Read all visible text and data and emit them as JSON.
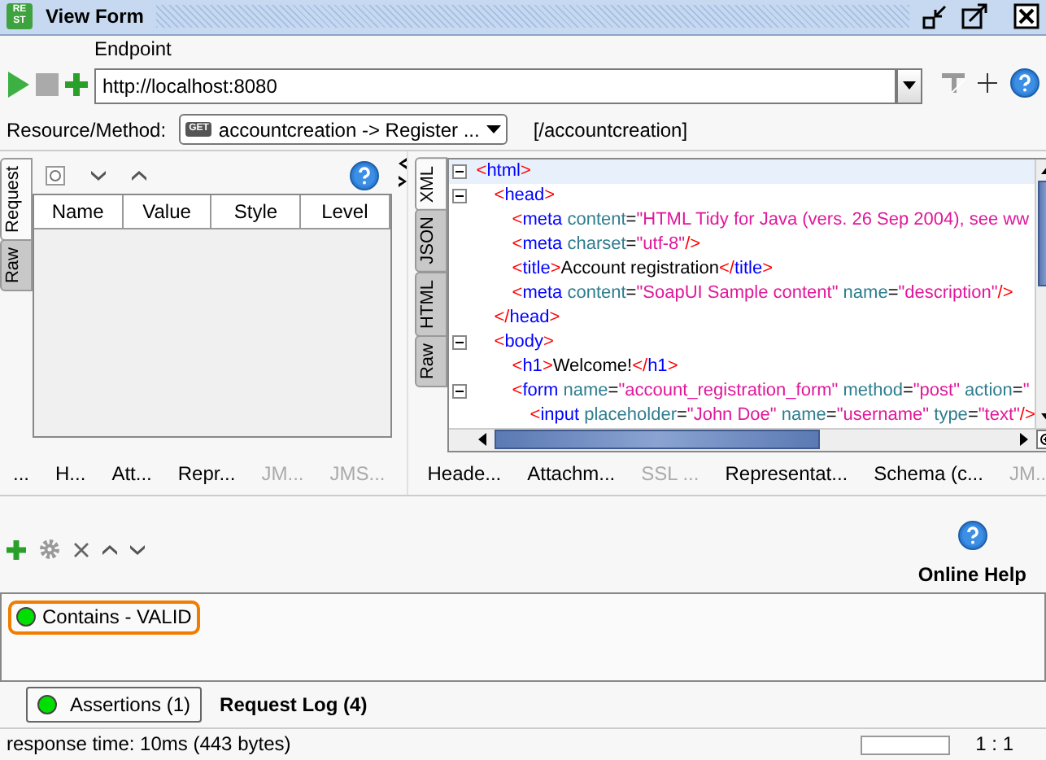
{
  "window": {
    "title": "View Form",
    "icon_text": [
      "RE",
      "ST"
    ]
  },
  "toolbar": {
    "endpoint_label": "Endpoint",
    "endpoint_value": "http://localhost:8080"
  },
  "resource": {
    "label": "Resource/Method:",
    "method": "GET",
    "value": "accountcreation -> Register ...",
    "path": "[/accountcreation]"
  },
  "request_panel": {
    "side_tabs": [
      {
        "label": "Request",
        "selected": true
      },
      {
        "label": "Raw",
        "selected": false
      }
    ],
    "columns": [
      "Name",
      "Value",
      "Style",
      "Level"
    ],
    "bottom_tabs": [
      {
        "label": "...",
        "disabled": false
      },
      {
        "label": "H...",
        "disabled": false
      },
      {
        "label": "Att...",
        "disabled": false
      },
      {
        "label": "Repr...",
        "disabled": false
      },
      {
        "label": "JM...",
        "disabled": true
      },
      {
        "label": "JMS...",
        "disabled": true
      }
    ]
  },
  "response_panel": {
    "side_tabs": [
      {
        "label": "XML",
        "selected": true
      },
      {
        "label": "JSON",
        "selected": false
      },
      {
        "label": "HTML",
        "selected": false
      },
      {
        "label": "Raw",
        "selected": false
      }
    ],
    "code": [
      {
        "selected": true,
        "expanded": true,
        "tokens": [
          {
            "kind": "bracket",
            "text": "<"
          },
          {
            "kind": "name",
            "text": "html"
          },
          {
            "kind": "bracket",
            "text": ">"
          }
        ],
        "children": [
          {
            "selected": false,
            "expanded": true,
            "tokens": [
              {
                "kind": "bracket",
                "text": "<"
              },
              {
                "kind": "name",
                "text": "head"
              },
              {
                "kind": "bracket",
                "text": ">"
              }
            ],
            "children": [
              {
                "selected": false,
                "tokens": [
                  {
                    "kind": "bracket",
                    "text": "<"
                  },
                  {
                    "kind": "name",
                    "text": "meta"
                  },
                  {
                    "kind": "attr",
                    "text": " content"
                  },
                  {
                    "kind": "eq",
                    "text": "="
                  },
                  {
                    "kind": "value",
                    "text": "\"HTML Tidy for Java (vers. 26 Sep 2004), see ww"
                  }
                ]
              },
              {
                "selected": false,
                "tokens": [
                  {
                    "kind": "bracket",
                    "text": "<"
                  },
                  {
                    "kind": "name",
                    "text": "meta"
                  },
                  {
                    "kind": "attr",
                    "text": " charset"
                  },
                  {
                    "kind": "eq",
                    "text": "="
                  },
                  {
                    "kind": "value",
                    "text": "\"utf-8\""
                  },
                  {
                    "kind": "bracket",
                    "text": "/>"
                  }
                ]
              },
              {
                "selected": false,
                "tokens": [
                  {
                    "kind": "bracket",
                    "text": "<"
                  },
                  {
                    "kind": "name",
                    "text": "title"
                  },
                  {
                    "kind": "bracket",
                    "text": ">"
                  },
                  {
                    "kind": "text",
                    "text": "Account registration"
                  },
                  {
                    "kind": "bracket",
                    "text": "</"
                  },
                  {
                    "kind": "name",
                    "text": "title"
                  },
                  {
                    "kind": "bracket",
                    "text": ">"
                  }
                ]
              },
              {
                "selected": false,
                "tokens": [
                  {
                    "kind": "bracket",
                    "text": "<"
                  },
                  {
                    "kind": "name",
                    "text": "meta"
                  },
                  {
                    "kind": "attr",
                    "text": " content"
                  },
                  {
                    "kind": "eq",
                    "text": "="
                  },
                  {
                    "kind": "value",
                    "text": "\"SoapUI Sample content\""
                  },
                  {
                    "kind": "attr",
                    "text": " name"
                  },
                  {
                    "kind": "eq",
                    "text": "="
                  },
                  {
                    "kind": "value",
                    "text": "\"description\""
                  },
                  {
                    "kind": "bracket",
                    "text": "/>"
                  }
                ]
              }
            ]
          },
          {
            "selected": false,
            "tokens": [
              {
                "kind": "bracket",
                "text": "</"
              },
              {
                "kind": "name",
                "text": "head"
              },
              {
                "kind": "bracket",
                "text": ">"
              }
            ]
          },
          {
            "selected": false,
            "expanded": true,
            "tokens": [
              {
                "kind": "bracket",
                "text": "<"
              },
              {
                "kind": "name",
                "text": "body"
              },
              {
                "kind": "bracket",
                "text": ">"
              }
            ],
            "children": [
              {
                "selected": false,
                "tokens": [
                  {
                    "kind": "bracket",
                    "text": "<"
                  },
                  {
                    "kind": "name",
                    "text": "h1"
                  },
                  {
                    "kind": "bracket",
                    "text": ">"
                  },
                  {
                    "kind": "text",
                    "text": "Welcome!"
                  },
                  {
                    "kind": "bracket",
                    "text": "</"
                  },
                  {
                    "kind": "name",
                    "text": "h1"
                  },
                  {
                    "kind": "bracket",
                    "text": ">"
                  }
                ]
              },
              {
                "selected": false,
                "expanded": true,
                "tokens": [
                  {
                    "kind": "bracket",
                    "text": "<"
                  },
                  {
                    "kind": "name",
                    "text": "form"
                  },
                  {
                    "kind": "attr",
                    "text": " name"
                  },
                  {
                    "kind": "eq",
                    "text": "="
                  },
                  {
                    "kind": "value",
                    "text": "\"account_registration_form\""
                  },
                  {
                    "kind": "attr",
                    "text": " method"
                  },
                  {
                    "kind": "eq",
                    "text": "="
                  },
                  {
                    "kind": "value",
                    "text": "\"post\""
                  },
                  {
                    "kind": "attr",
                    "text": " action"
                  },
                  {
                    "kind": "eq",
                    "text": "="
                  },
                  {
                    "kind": "value",
                    "text": "\""
                  }
                ],
                "children": [
                  {
                    "selected": false,
                    "tokens": [
                      {
                        "kind": "bracket",
                        "text": "<"
                      },
                      {
                        "kind": "name",
                        "text": "input"
                      },
                      {
                        "kind": "attr",
                        "text": " placeholder"
                      },
                      {
                        "kind": "eq",
                        "text": "="
                      },
                      {
                        "kind": "value",
                        "text": "\"John Doe\""
                      },
                      {
                        "kind": "attr",
                        "text": " name"
                      },
                      {
                        "kind": "eq",
                        "text": "="
                      },
                      {
                        "kind": "value",
                        "text": "\"username\""
                      },
                      {
                        "kind": "attr",
                        "text": " type"
                      },
                      {
                        "kind": "eq",
                        "text": "="
                      },
                      {
                        "kind": "value",
                        "text": "\"text\""
                      },
                      {
                        "kind": "bracket",
                        "text": "/>"
                      }
                    ]
                  }
                ]
              }
            ]
          }
        ]
      }
    ],
    "bottom_tabs": [
      {
        "label": "Heade...",
        "disabled": false
      },
      {
        "label": "Attachm...",
        "disabled": false
      },
      {
        "label": "SSL ...",
        "disabled": true
      },
      {
        "label": "Representat...",
        "disabled": false
      },
      {
        "label": "Schema (c...",
        "disabled": false
      },
      {
        "label": "JM...",
        "disabled": true
      }
    ]
  },
  "assertions": {
    "help_label": "Online Help",
    "items": [
      {
        "label": "Contains - VALID",
        "color": "#00e000",
        "highlighted": true
      }
    ]
  },
  "tabs": [
    {
      "label": "Assertions (1)",
      "selected": true,
      "color": "#00e000"
    },
    {
      "label": "Request Log (4)",
      "selected": false
    }
  ],
  "status_bar": {
    "text": "response time: 10ms (443 bytes)",
    "position": "1 : 1"
  }
}
